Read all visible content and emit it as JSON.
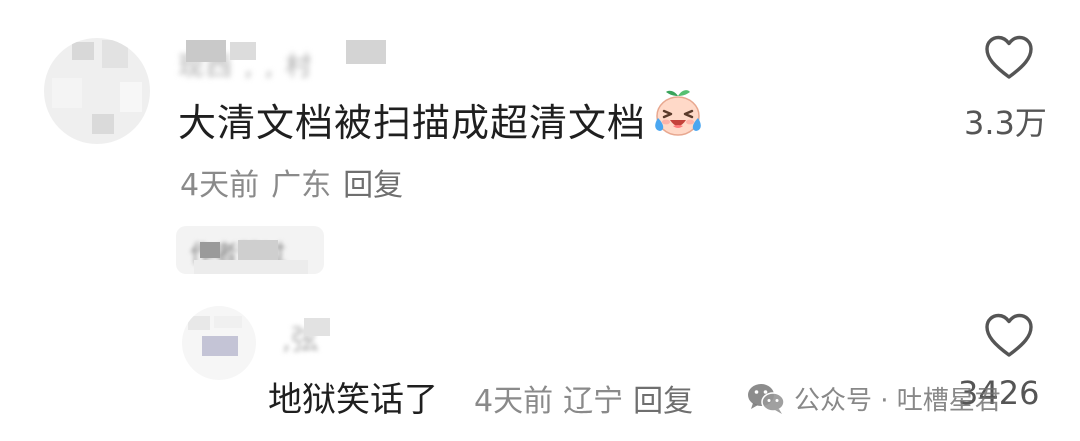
{
  "comments": [
    {
      "username": "现西 , , 村",
      "text": "大清文档被扫描成超清文档",
      "emoji": "laughing-crying-face",
      "time": "4天前",
      "location": "广东",
      "reply": "回复",
      "likes": "3.3万",
      "author_tag": "作者赞过"
    },
    {
      "username": "  ,弦",
      "text": "地狱笑话了",
      "time": "4天前",
      "location": "辽宁",
      "reply": "回复",
      "likes": "3426"
    }
  ],
  "watermark": {
    "text": "公众号 · 吐槽星君",
    "icon": "wechat-icon"
  },
  "colors": {
    "text_primary": "#1f1f1f",
    "text_secondary": "#8a8a8a",
    "heart_outline": "#555555"
  }
}
